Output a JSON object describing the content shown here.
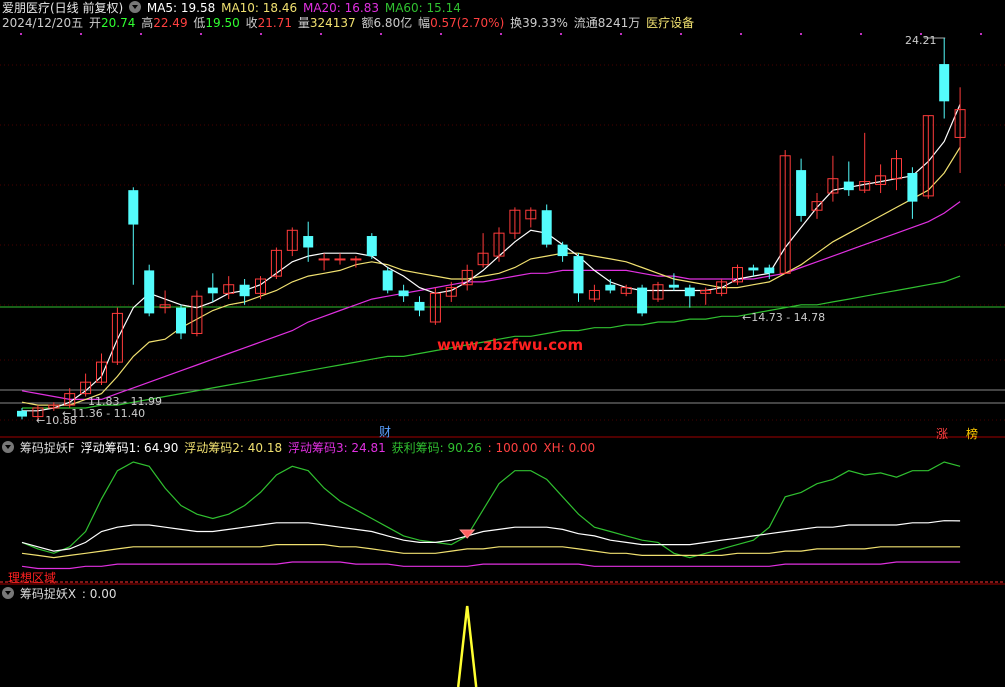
{
  "title": {
    "stock": "爱朋医疗(日线 前复权)",
    "ma5": "MA5: 19.58",
    "ma10": "MA10: 18.46",
    "ma20": "MA20: 16.83",
    "ma60": "MA60: 15.14"
  },
  "info": {
    "date": "2024/12/20五",
    "open_label": "开",
    "open": "20.74",
    "high_label": "高",
    "high": "22.49",
    "low_label": "低",
    "low": "19.50",
    "close_label": "收",
    "close": "21.71",
    "vol_label": "量",
    "vol": "324137",
    "amount_label": "额",
    "amount": "6.80亿",
    "change_label": "幅",
    "change": "0.57(2.70%)",
    "turnover": "换39.33%",
    "float": "流通8241万",
    "industry": "医疗设备"
  },
  "main_chart": {
    "annotations": {
      "high_mark": "24.21",
      "range_mid": "←14.73 - 14.78",
      "range_low1": "11.83 - 11.99",
      "range_low2": "←11.36 - 11.40",
      "low_mark": "←10.88",
      "watermark": "www.zbzfwu.com"
    },
    "badges": {
      "cai": "财",
      "zhang": "涨",
      "bang": "榜"
    },
    "colors": {
      "up": "#ff3b3b",
      "down": "#54fcfc",
      "ma5": "#ffffff",
      "ma10": "#f0e070",
      "ma20": "#e030e0",
      "ma60": "#30c030"
    }
  },
  "indicator1": {
    "name": "筹码捉妖F",
    "f1": "浮动筹码1: 64.90",
    "f2": "浮动筹码2: 40.18",
    "f3": "浮动筹码3: 24.81",
    "profit": "获利筹码: 90.26",
    "hundred": ": 100.00",
    "xh": "XH: 0.00",
    "tag": "理想区域"
  },
  "indicator2": {
    "name": "筹码捉妖X",
    "value": ": 0.00"
  },
  "chart_data": {
    "type": "candlestick",
    "candles": [
      {
        "o": 11.2,
        "c": 11.0,
        "h": 11.3,
        "l": 10.9
      },
      {
        "o": 11.0,
        "c": 11.3,
        "h": 11.4,
        "l": 10.88
      },
      {
        "o": 11.3,
        "c": 11.4,
        "h": 11.5,
        "l": 11.2
      },
      {
        "o": 11.4,
        "c": 11.8,
        "h": 11.99,
        "l": 11.3
      },
      {
        "o": 11.8,
        "c": 12.2,
        "h": 12.5,
        "l": 11.7
      },
      {
        "o": 12.2,
        "c": 12.9,
        "h": 13.2,
        "l": 12.1
      },
      {
        "o": 12.9,
        "c": 14.6,
        "h": 14.8,
        "l": 12.8
      },
      {
        "o": 18.9,
        "c": 17.7,
        "h": 19.0,
        "l": 15.6
      },
      {
        "o": 16.1,
        "c": 14.6,
        "h": 16.3,
        "l": 14.5
      },
      {
        "o": 14.8,
        "c": 14.9,
        "h": 15.4,
        "l": 14.6
      },
      {
        "o": 14.8,
        "c": 13.9,
        "h": 14.9,
        "l": 13.7
      },
      {
        "o": 13.9,
        "c": 15.2,
        "h": 15.4,
        "l": 13.8
      },
      {
        "o": 15.5,
        "c": 15.3,
        "h": 16.0,
        "l": 15.0
      },
      {
        "o": 15.3,
        "c": 15.6,
        "h": 15.9,
        "l": 15.1
      },
      {
        "o": 15.6,
        "c": 15.2,
        "h": 15.8,
        "l": 14.9
      },
      {
        "o": 15.3,
        "c": 15.8,
        "h": 15.9,
        "l": 15.1
      },
      {
        "o": 15.9,
        "c": 16.8,
        "h": 16.9,
        "l": 15.8
      },
      {
        "o": 16.8,
        "c": 17.5,
        "h": 17.6,
        "l": 16.6
      },
      {
        "o": 17.3,
        "c": 16.9,
        "h": 17.8,
        "l": 16.4
      },
      {
        "o": 16.5,
        "c": 16.5,
        "h": 16.7,
        "l": 16.1
      },
      {
        "o": 16.5,
        "c": 16.5,
        "h": 16.7,
        "l": 16.3
      },
      {
        "o": 16.5,
        "c": 16.5,
        "h": 16.6,
        "l": 16.2
      },
      {
        "o": 17.3,
        "c": 16.6,
        "h": 17.4,
        "l": 16.5
      },
      {
        "o": 16.1,
        "c": 15.4,
        "h": 16.2,
        "l": 15.3
      },
      {
        "o": 15.4,
        "c": 15.2,
        "h": 15.6,
        "l": 15.0
      },
      {
        "o": 15.0,
        "c": 14.7,
        "h": 15.2,
        "l": 14.5
      },
      {
        "o": 14.3,
        "c": 15.3,
        "h": 15.5,
        "l": 14.2
      },
      {
        "o": 15.2,
        "c": 15.5,
        "h": 15.7,
        "l": 15.0
      },
      {
        "o": 15.6,
        "c": 16.1,
        "h": 16.3,
        "l": 15.4
      },
      {
        "o": 16.3,
        "c": 16.7,
        "h": 17.4,
        "l": 16.2
      },
      {
        "o": 16.6,
        "c": 17.4,
        "h": 17.6,
        "l": 16.4
      },
      {
        "o": 17.4,
        "c": 18.2,
        "h": 18.3,
        "l": 17.2
      },
      {
        "o": 17.9,
        "c": 18.2,
        "h": 18.3,
        "l": 17.6
      },
      {
        "o": 18.2,
        "c": 17.0,
        "h": 18.4,
        "l": 16.9
      },
      {
        "o": 17.0,
        "c": 16.6,
        "h": 17.1,
        "l": 16.4
      },
      {
        "o": 16.6,
        "c": 15.3,
        "h": 16.7,
        "l": 15.0
      },
      {
        "o": 15.1,
        "c": 15.4,
        "h": 15.6,
        "l": 15.0
      },
      {
        "o": 15.6,
        "c": 15.4,
        "h": 15.8,
        "l": 15.3
      },
      {
        "o": 15.3,
        "c": 15.5,
        "h": 15.6,
        "l": 15.2
      },
      {
        "o": 15.5,
        "c": 14.6,
        "h": 15.6,
        "l": 14.5
      },
      {
        "o": 15.1,
        "c": 15.6,
        "h": 15.7,
        "l": 15.0
      },
      {
        "o": 15.6,
        "c": 15.5,
        "h": 16.0,
        "l": 15.4
      },
      {
        "o": 15.5,
        "c": 15.2,
        "h": 15.6,
        "l": 14.8
      },
      {
        "o": 15.3,
        "c": 15.4,
        "h": 15.5,
        "l": 14.9
      },
      {
        "o": 15.3,
        "c": 15.7,
        "h": 15.8,
        "l": 15.2
      },
      {
        "o": 15.7,
        "c": 16.2,
        "h": 16.3,
        "l": 15.6
      },
      {
        "o": 16.2,
        "c": 16.1,
        "h": 16.3,
        "l": 15.9
      },
      {
        "o": 16.2,
        "c": 16.0,
        "h": 16.3,
        "l": 15.8
      },
      {
        "o": 16.0,
        "c": 20.1,
        "h": 20.3,
        "l": 16.0
      },
      {
        "o": 19.6,
        "c": 18.0,
        "h": 20.0,
        "l": 17.8
      },
      {
        "o": 18.2,
        "c": 18.5,
        "h": 18.8,
        "l": 17.9
      },
      {
        "o": 18.8,
        "c": 19.3,
        "h": 20.1,
        "l": 18.5
      },
      {
        "o": 19.2,
        "c": 18.9,
        "h": 19.9,
        "l": 18.7
      },
      {
        "o": 18.9,
        "c": 19.2,
        "h": 20.9,
        "l": 18.8
      },
      {
        "o": 19.1,
        "c": 19.4,
        "h": 19.8,
        "l": 18.8
      },
      {
        "o": 19.3,
        "c": 20.0,
        "h": 20.3,
        "l": 18.9
      },
      {
        "o": 19.5,
        "c": 18.5,
        "h": 19.7,
        "l": 17.9
      },
      {
        "o": 18.7,
        "c": 21.5,
        "h": 21.5,
        "l": 18.6
      },
      {
        "o": 23.3,
        "c": 22.0,
        "h": 24.21,
        "l": 21.4
      },
      {
        "o": 20.74,
        "c": 21.71,
        "h": 22.49,
        "l": 19.5
      }
    ],
    "ma5": [
      11.2,
      11.2,
      11.3,
      11.5,
      11.9,
      12.4,
      13.7,
      14.8,
      15.3,
      15.1,
      14.9,
      14.8,
      15.0,
      15.3,
      15.4,
      15.6,
      16.0,
      16.4,
      16.6,
      16.7,
      16.7,
      16.7,
      16.6,
      16.2,
      15.9,
      15.5,
      15.3,
      15.4,
      15.7,
      16.1,
      16.6,
      17.1,
      17.5,
      17.4,
      17.0,
      16.6,
      16.1,
      15.7,
      15.5,
      15.4,
      15.4,
      15.4,
      15.4,
      15.4,
      15.5,
      15.8,
      15.9,
      16.0,
      16.9,
      17.6,
      18.3,
      18.9,
      19.0,
      19.1,
      19.2,
      19.3,
      19.4,
      19.9,
      20.6,
      21.9
    ],
    "ma10": [
      11.5,
      11.4,
      11.4,
      11.4,
      11.6,
      11.8,
      12.4,
      13.1,
      13.6,
      13.7,
      14.1,
      14.4,
      14.7,
      14.9,
      15.0,
      15.2,
      15.4,
      15.7,
      15.9,
      16.0,
      16.1,
      16.3,
      16.4,
      16.3,
      16.1,
      16.0,
      15.9,
      15.8,
      15.8,
      15.9,
      16.0,
      16.2,
      16.5,
      16.6,
      16.7,
      16.7,
      16.6,
      16.5,
      16.4,
      16.2,
      16.0,
      15.8,
      15.7,
      15.6,
      15.5,
      15.5,
      15.6,
      15.7,
      16.0,
      16.3,
      16.7,
      17.1,
      17.4,
      17.7,
      18.0,
      18.3,
      18.6,
      18.9,
      19.5,
      20.4
    ],
    "ma20": [
      11.9,
      11.8,
      11.7,
      11.6,
      11.6,
      11.6,
      11.8,
      12.0,
      12.2,
      12.4,
      12.6,
      12.8,
      13.0,
      13.2,
      13.4,
      13.6,
      13.8,
      14.0,
      14.3,
      14.5,
      14.7,
      14.9,
      15.1,
      15.2,
      15.3,
      15.4,
      15.5,
      15.6,
      15.7,
      15.7,
      15.8,
      15.9,
      16.0,
      16.0,
      16.1,
      16.1,
      16.1,
      16.1,
      16.1,
      16.0,
      15.9,
      15.9,
      15.8,
      15.8,
      15.8,
      15.8,
      15.8,
      15.9,
      16.0,
      16.2,
      16.4,
      16.6,
      16.8,
      17.0,
      17.2,
      17.4,
      17.6,
      17.8,
      18.1,
      18.5
    ],
    "ma60": [
      11.3,
      11.3,
      11.3,
      11.3,
      11.3,
      11.4,
      11.4,
      11.5,
      11.6,
      11.7,
      11.8,
      11.9,
      12.0,
      12.1,
      12.2,
      12.3,
      12.4,
      12.5,
      12.6,
      12.7,
      12.8,
      12.9,
      13.0,
      13.1,
      13.1,
      13.2,
      13.3,
      13.4,
      13.5,
      13.6,
      13.7,
      13.8,
      13.8,
      13.9,
      14.0,
      14.0,
      14.1,
      14.1,
      14.2,
      14.2,
      14.3,
      14.3,
      14.4,
      14.4,
      14.5,
      14.5,
      14.6,
      14.7,
      14.8,
      14.9,
      14.9,
      15.0,
      15.1,
      15.2,
      15.3,
      15.4,
      15.5,
      15.6,
      15.7,
      15.9
    ],
    "indicator1": {
      "profit": [
        55,
        52,
        50,
        53,
        60,
        75,
        88,
        92,
        90,
        80,
        72,
        68,
        66,
        68,
        72,
        78,
        86,
        90,
        88,
        80,
        74,
        70,
        66,
        62,
        58,
        56,
        55,
        54,
        58,
        70,
        82,
        88,
        88,
        84,
        76,
        68,
        62,
        60,
        58,
        56,
        55,
        50,
        48,
        50,
        52,
        54,
        56,
        62,
        76,
        78,
        82,
        84,
        88,
        86,
        87,
        85,
        88,
        88,
        92,
        90
      ],
      "f1": [
        55,
        53,
        51,
        52,
        55,
        60,
        62,
        63,
        63,
        62,
        61,
        60,
        60,
        61,
        62,
        63,
        64,
        64,
        64,
        63,
        62,
        61,
        60,
        58,
        56,
        55,
        55,
        56,
        58,
        60,
        61,
        62,
        62,
        62,
        61,
        59,
        58,
        56,
        55,
        54,
        54,
        54,
        54,
        55,
        56,
        57,
        58,
        59,
        60,
        61,
        62,
        62,
        63,
        63,
        63,
        63,
        64,
        64,
        65,
        64.9
      ],
      "f2": [
        50,
        49,
        48,
        49,
        50,
        51,
        52,
        53,
        53,
        53,
        53,
        53,
        53,
        53,
        53,
        53,
        54,
        54,
        54,
        54,
        53,
        53,
        52,
        51,
        50,
        50,
        50,
        51,
        52,
        52,
        53,
        53,
        53,
        53,
        53,
        52,
        51,
        50,
        50,
        49,
        49,
        49,
        49,
        49,
        49,
        50,
        50,
        50,
        51,
        51,
        52,
        52,
        52,
        52,
        53,
        53,
        53,
        53,
        53,
        53
      ],
      "f3": [
        44,
        43,
        43,
        43,
        44,
        44,
        45,
        45,
        45,
        45,
        45,
        45,
        45,
        45,
        45,
        45,
        45,
        46,
        46,
        46,
        46,
        45,
        45,
        45,
        44,
        44,
        44,
        44,
        44,
        45,
        45,
        45,
        45,
        45,
        45,
        45,
        44,
        44,
        44,
        44,
        44,
        44,
        44,
        44,
        44,
        44,
        44,
        44,
        45,
        45,
        45,
        45,
        45,
        45,
        45,
        46,
        46,
        46,
        46,
        46
      ]
    }
  }
}
